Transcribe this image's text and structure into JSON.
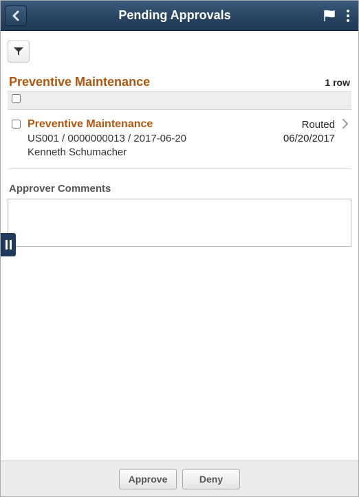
{
  "header": {
    "title": "Pending Approvals"
  },
  "section": {
    "title": "Preventive Maintenance",
    "row_count": "1 row"
  },
  "items": [
    {
      "title": "Preventive Maintenance",
      "detail": "US001 / 0000000013 / 2017-06-20",
      "person": "Kenneth Schumacher",
      "status": "Routed",
      "date": "06/20/2017"
    }
  ],
  "comments": {
    "label": "Approver Comments",
    "value": ""
  },
  "footer": {
    "approve_label": "Approve",
    "deny_label": "Deny"
  }
}
